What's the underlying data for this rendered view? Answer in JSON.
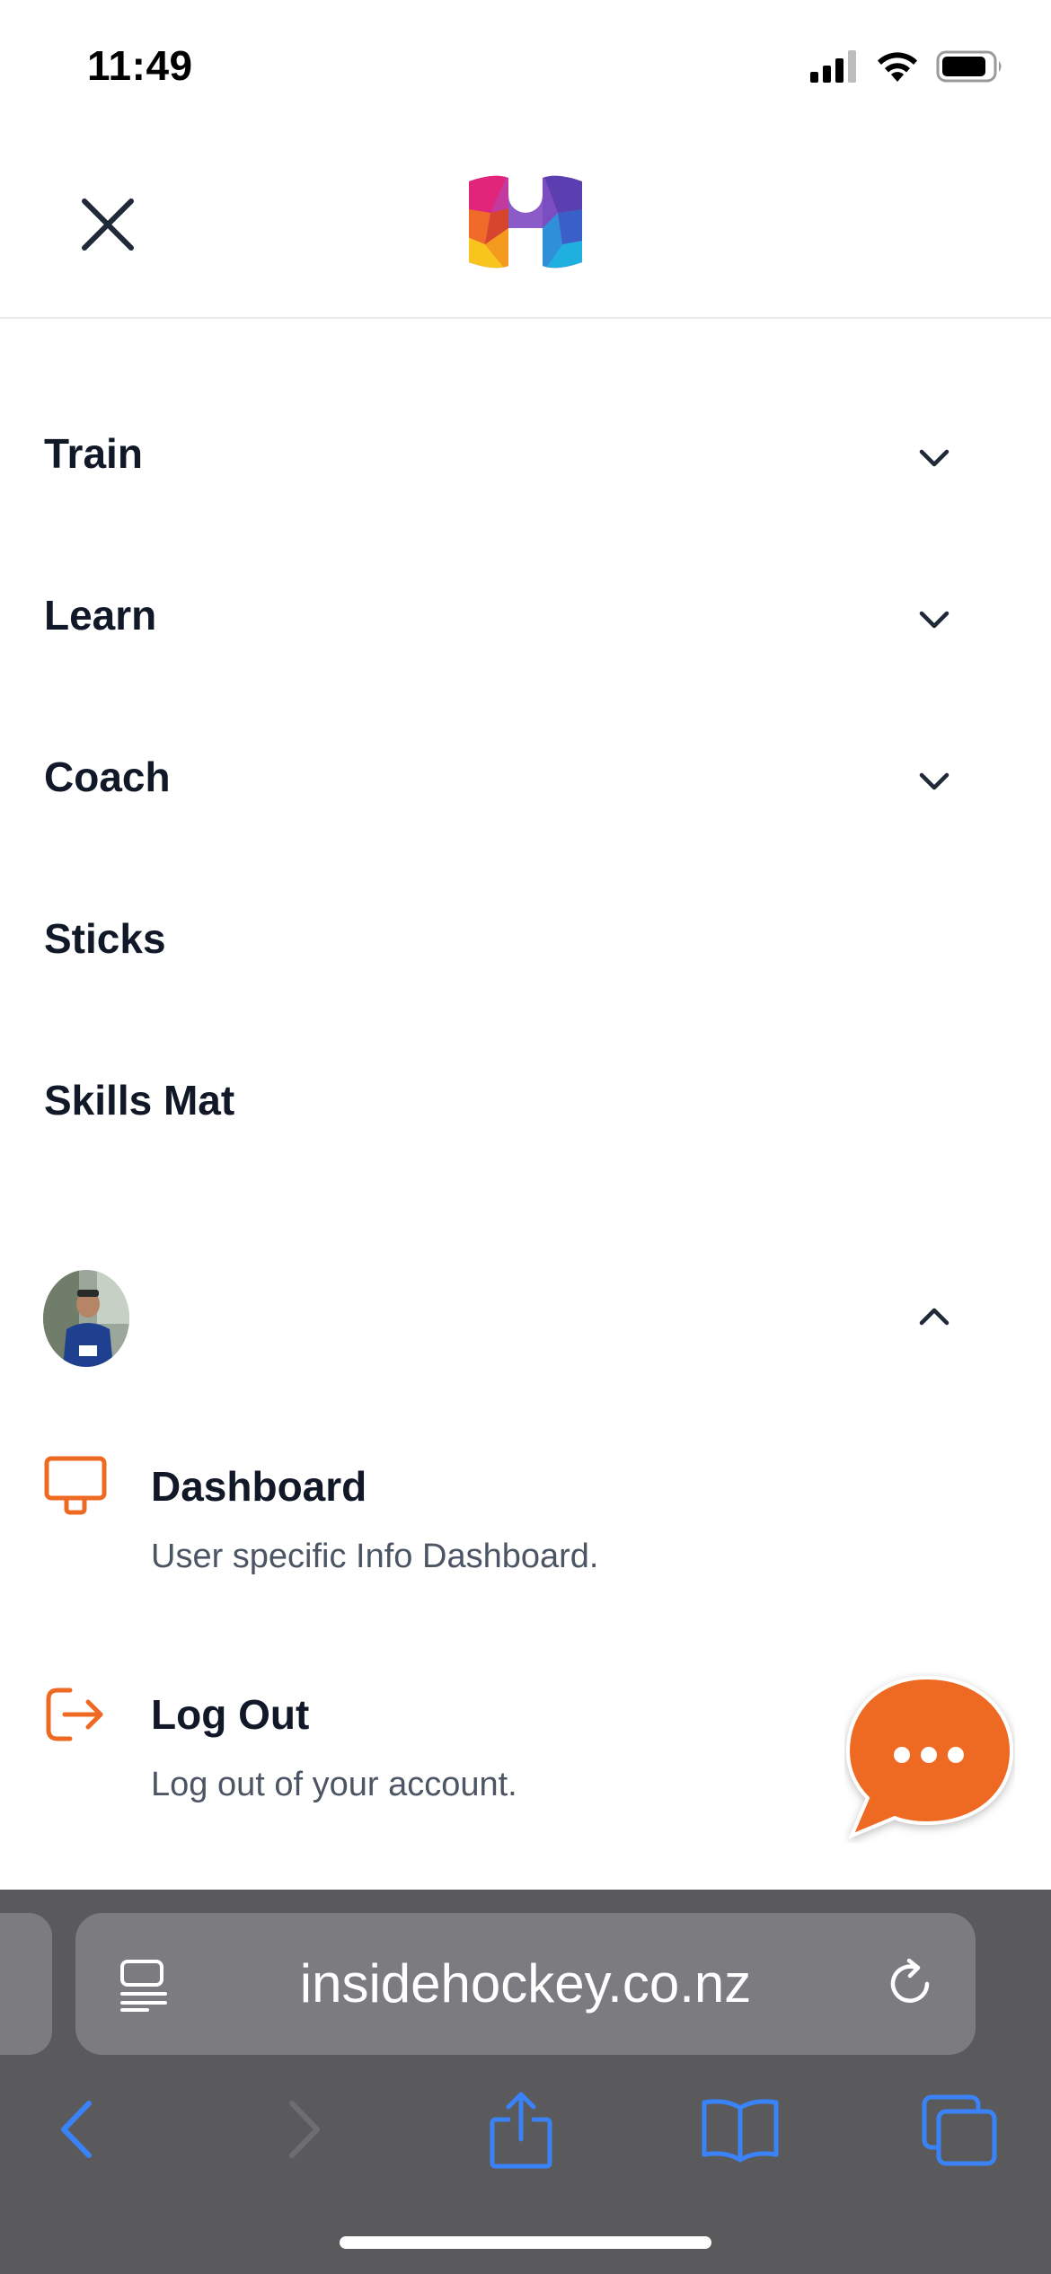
{
  "status_bar": {
    "time": "11:49"
  },
  "header": {
    "close_icon": "close-icon",
    "logo_icon": "insidehockey-logo"
  },
  "menu": {
    "items": [
      {
        "label": "Train",
        "expandable": true
      },
      {
        "label": "Learn",
        "expandable": true
      },
      {
        "label": "Coach",
        "expandable": true
      },
      {
        "label": "Sticks",
        "expandable": false
      },
      {
        "label": "Skills Mat",
        "expandable": false
      }
    ]
  },
  "account": {
    "expanded": true,
    "items": [
      {
        "title": "Dashboard",
        "description": "User specific Info Dashboard.",
        "icon": "monitor-icon"
      },
      {
        "title": "Log Out",
        "description": "Log out of your account.",
        "icon": "logout-icon"
      }
    ]
  },
  "chat": {
    "icon": "chat-bubble-icon"
  },
  "browser": {
    "url": "insidehockey.co.nz"
  },
  "colors": {
    "accent": "#ee6a22",
    "text": "#111827",
    "muted": "#4b5563",
    "browser_chrome": "#5a5a5c",
    "browser_field": "#7c7c80",
    "browser_blue": "#3a82f7"
  }
}
